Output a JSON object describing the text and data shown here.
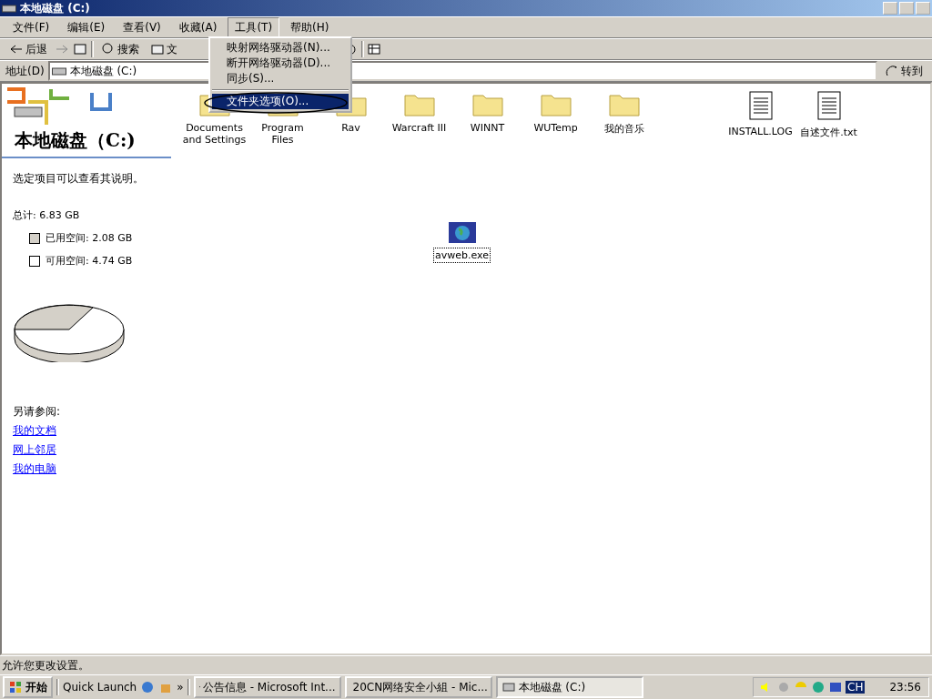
{
  "window": {
    "title": "本地磁盘 (C:)"
  },
  "menu_bar": [
    {
      "label": "文件(F)",
      "selected": false
    },
    {
      "label": "编辑(E)",
      "selected": false
    },
    {
      "label": "查看(V)",
      "selected": false
    },
    {
      "label": "收藏(A)",
      "selected": false
    },
    {
      "label": "工具(T)",
      "selected": true
    },
    {
      "label": "帮助(H)",
      "selected": false
    }
  ],
  "tools_menu": [
    {
      "label": "映射网络驱动器(N)...",
      "selected": false
    },
    {
      "label": "断开网络驱动器(D)...",
      "selected": false
    },
    {
      "label": "同步(S)...",
      "selected": false
    },
    {
      "label": "文件夹选项(O)...",
      "selected": true
    }
  ],
  "toolbar": {
    "back": "后退",
    "search": "搜索",
    "folders": "文"
  },
  "address_bar": {
    "label": "地址(D)",
    "value": "本地磁盘 (C:)",
    "go": "转到"
  },
  "left_panel": {
    "title": "本地磁盘（C:)",
    "hint": "选定项目可以查看其说明。",
    "total": "总计: 6.83 GB",
    "legend": [
      {
        "label": "已用空间: 2.08 GB",
        "color": "#d4d0c8"
      },
      {
        "label": "可用空间: 4.74 GB",
        "color": "#ffffff"
      }
    ],
    "see_also": "另请参阅:",
    "links": [
      "我的文档",
      "网上邻居",
      "我的电脑"
    ]
  },
  "items": [
    {
      "name": "Documents and Settings",
      "kind": "folder"
    },
    {
      "name": "Program Files",
      "kind": "folder"
    },
    {
      "name": "Rav",
      "kind": "folder"
    },
    {
      "name": "Warcraft III",
      "kind": "folder"
    },
    {
      "name": "WINNT",
      "kind": "folder"
    },
    {
      "name": "WUTemp",
      "kind": "folder"
    },
    {
      "name": "我的音乐",
      "kind": "folder"
    },
    {
      "name": "INSTALL.LOG",
      "kind": "file"
    },
    {
      "name": "自述文件.txt",
      "kind": "file"
    }
  ],
  "selected_item": {
    "name": "avweb.exe",
    "selected": true
  },
  "status_bar": "允许您更改设置。",
  "taskbar": {
    "start": "开始",
    "quick_launch": "Quick Launch",
    "more": "»",
    "tasks": [
      {
        "label": "公告信息 - Microsoft Int...",
        "selected": false
      },
      {
        "label": "20CN网络安全小組 - Mic...",
        "selected": false
      },
      {
        "label": "本地磁盘 (C:)",
        "selected": true
      }
    ],
    "tray_lang": "CH",
    "clock": "23:56"
  }
}
